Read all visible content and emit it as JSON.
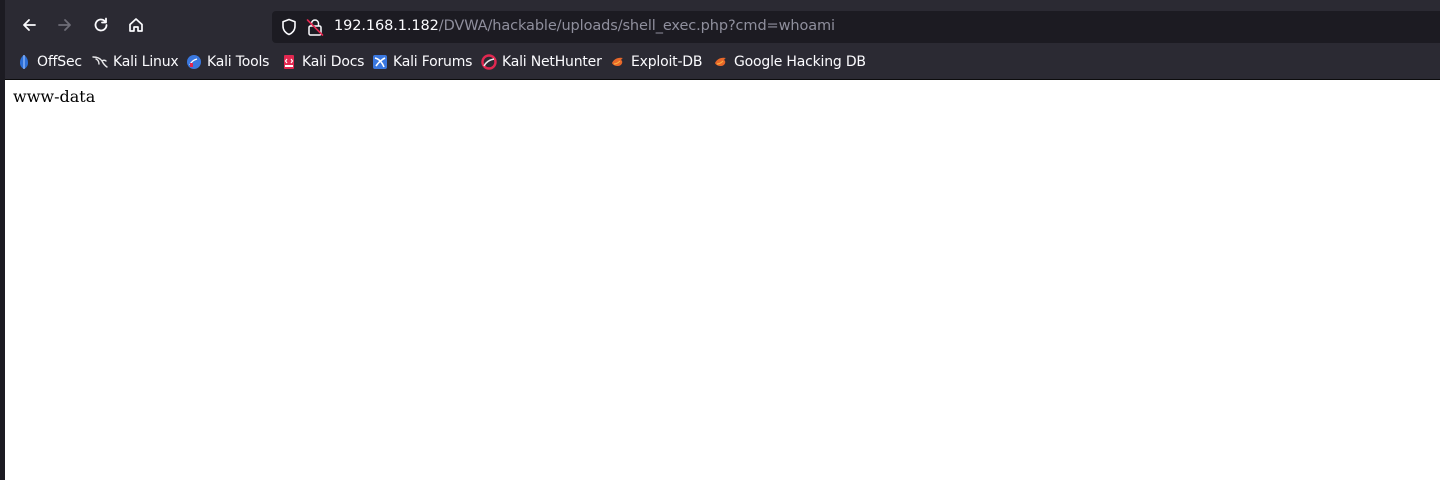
{
  "navigation": {
    "back": "back-arrow-icon",
    "forward": "forward-arrow-icon",
    "reload": "reload-icon",
    "home": "home-icon"
  },
  "urlbar": {
    "host": "192.168.1.182",
    "path": "/DVWA/hackable/uploads/shell_exec.php?cmd=whoami"
  },
  "bookmarks": [
    {
      "label": "OffSec",
      "icon": "offsec-icon"
    },
    {
      "label": "Kali Linux",
      "icon": "kali-dragon-icon"
    },
    {
      "label": "Kali Tools",
      "icon": "kali-tools-icon"
    },
    {
      "label": "Kali Docs",
      "icon": "kali-docs-icon"
    },
    {
      "label": "Kali Forums",
      "icon": "kali-forums-icon"
    },
    {
      "label": "Kali NetHunter",
      "icon": "nethunter-icon"
    },
    {
      "label": "Exploit-DB",
      "icon": "exploit-db-icon"
    },
    {
      "label": "Google Hacking DB",
      "icon": "ghdb-icon"
    }
  ],
  "page": {
    "output": "www-data"
  },
  "colors": {
    "toolbar": "#2b2a33",
    "urlbar": "#1c1b22",
    "text": "#fbfbfe",
    "url_dim": "#8f8f9d"
  }
}
